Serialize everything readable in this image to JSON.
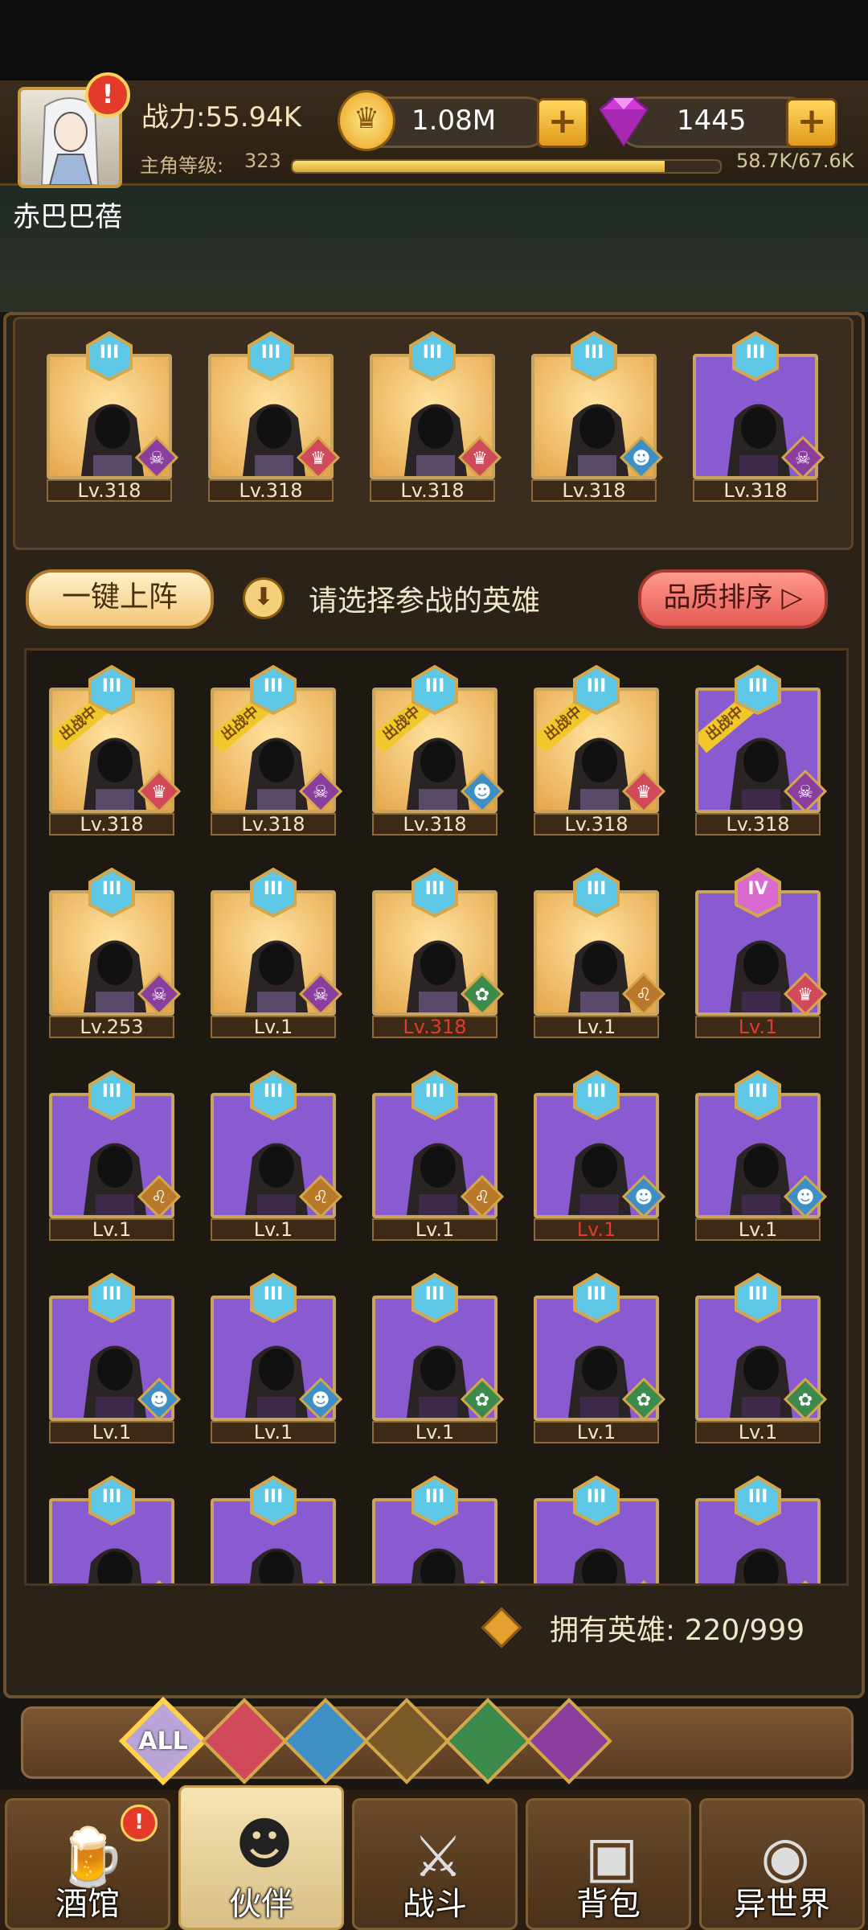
{
  "header": {
    "power": "战力:55.94K",
    "level_label": "主角等级:",
    "level_value": "323",
    "xp_text": "58.7K/67.6K",
    "xp_progress": 0.87,
    "gold": "1.08M",
    "gems": "1445",
    "player_name": "赤巴巴蓓",
    "alert": "!"
  },
  "team": [
    {
      "level": "Lv.318",
      "bg": "gold",
      "rank": "III",
      "faction": "orc"
    },
    {
      "level": "Lv.318",
      "bg": "gold",
      "rank": "III",
      "faction": "human"
    },
    {
      "level": "Lv.318",
      "bg": "gold",
      "rank": "III",
      "faction": "human"
    },
    {
      "level": "Lv.318",
      "bg": "gold",
      "rank": "III",
      "faction": "sea"
    },
    {
      "level": "Lv.318",
      "bg": "purple",
      "rank": "III",
      "faction": "orc"
    }
  ],
  "controls": {
    "deploy_label": "一键上阵",
    "prompt": "请选择参战的英雄",
    "sort_label": "品质排序",
    "sort_arrow": "▷"
  },
  "heroes": [
    {
      "level": "Lv.318",
      "bg": "gold",
      "rank": "III",
      "faction": "human",
      "tag": "出战中"
    },
    {
      "level": "Lv.318",
      "bg": "gold",
      "rank": "III",
      "faction": "orc",
      "tag": "出战中"
    },
    {
      "level": "Lv.318",
      "bg": "gold",
      "rank": "III",
      "faction": "sea",
      "tag": "出战中"
    },
    {
      "level": "Lv.318",
      "bg": "gold",
      "rank": "III",
      "faction": "human",
      "tag": "出战中"
    },
    {
      "level": "Lv.318",
      "bg": "purple",
      "rank": "III",
      "faction": "orc",
      "tag": "出战中"
    },
    {
      "level": "Lv.253",
      "bg": "gold",
      "rank": "III",
      "faction": "orc"
    },
    {
      "level": "Lv.1",
      "bg": "gold",
      "rank": "III",
      "faction": "orc"
    },
    {
      "level": "Lv.318",
      "bg": "gold",
      "rank": "III",
      "faction": "elf",
      "red": true
    },
    {
      "level": "Lv.1",
      "bg": "gold",
      "rank": "III",
      "faction": "beast"
    },
    {
      "level": "Lv.1",
      "bg": "purple",
      "rank": "IV",
      "faction": "human",
      "red": true
    },
    {
      "level": "Lv.1",
      "bg": "purple",
      "rank": "III",
      "faction": "beast"
    },
    {
      "level": "Lv.1",
      "bg": "purple",
      "rank": "III",
      "faction": "beast"
    },
    {
      "level": "Lv.1",
      "bg": "purple",
      "rank": "III",
      "faction": "beast"
    },
    {
      "level": "Lv.1",
      "bg": "purple",
      "rank": "III",
      "faction": "sea",
      "red": true
    },
    {
      "level": "Lv.1",
      "bg": "purple",
      "rank": "III",
      "faction": "sea"
    },
    {
      "level": "Lv.1",
      "bg": "purple",
      "rank": "III",
      "faction": "sea"
    },
    {
      "level": "Lv.1",
      "bg": "purple",
      "rank": "III",
      "faction": "sea"
    },
    {
      "level": "Lv.1",
      "bg": "purple",
      "rank": "III",
      "faction": "elf"
    },
    {
      "level": "Lv.1",
      "bg": "purple",
      "rank": "III",
      "faction": "elf"
    },
    {
      "level": "Lv.1",
      "bg": "purple",
      "rank": "III",
      "faction": "elf"
    },
    {
      "level": "",
      "bg": "purple",
      "rank": "III",
      "faction": "elf"
    },
    {
      "level": "",
      "bg": "purple",
      "rank": "III",
      "faction": "elf"
    },
    {
      "level": "",
      "bg": "purple",
      "rank": "III",
      "faction": "elf"
    },
    {
      "level": "",
      "bg": "purple",
      "rank": "III",
      "faction": "elf"
    },
    {
      "level": "",
      "bg": "purple",
      "rank": "III",
      "faction": "orc"
    }
  ],
  "hero_count": "拥有英雄:  220/999",
  "filters": [
    {
      "label": "ALL",
      "icon": "all-filter-icon",
      "color": "#b8a4d6"
    },
    {
      "label": "",
      "icon": "human-faction-icon",
      "color": "#d04a5a"
    },
    {
      "label": "",
      "icon": "sea-faction-icon",
      "color": "#3d8fc6"
    },
    {
      "label": "",
      "icon": "beast-faction-icon",
      "color": "#7b5a2a"
    },
    {
      "label": "",
      "icon": "elf-faction-icon",
      "color": "#3c8a4c"
    },
    {
      "label": "",
      "icon": "orc-faction-icon",
      "color": "#8a3e9e"
    }
  ],
  "nav": [
    {
      "label": "酒馆",
      "icon": "tavern-icon"
    },
    {
      "label": "伙伴",
      "icon": "partner-icon",
      "active": true
    },
    {
      "label": "战斗",
      "icon": "battle-icon"
    },
    {
      "label": "背包",
      "icon": "backpack-icon"
    },
    {
      "label": "异世界",
      "icon": "portal-icon"
    }
  ],
  "colors": {
    "accent_gold": "#f1c72b",
    "red_text": "#e23b2c",
    "panel": "#2b2218"
  }
}
